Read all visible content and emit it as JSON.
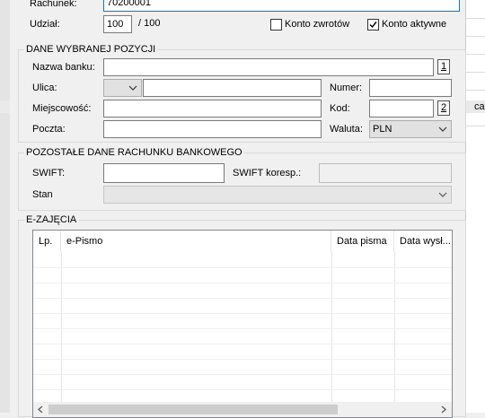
{
  "form": {
    "rachunek_label": "Rachunek:",
    "rachunek_value": "70200001",
    "udzial_label": "Udział:",
    "udzial_value": "100",
    "udzial_total": "/ 100",
    "konto_zwrotow_label": "Konto zwrotów",
    "konto_zwrotow_checked": false,
    "konto_aktywne_label": "Konto aktywne",
    "konto_aktywne_checked": true
  },
  "dane_pozycji": {
    "legend": "DANE WYBRANEJ POZYCJI",
    "nazwa_banku_label": "Nazwa banku:",
    "nazwa_banku_value": "",
    "btn1_label": "1",
    "ulica_label": "Ulica:",
    "ulica_prefix_value": "",
    "ulica_value": "",
    "numer_label": "Numer:",
    "numer_value": "",
    "miejscowosc_label": "Miejscowość:",
    "miejscowosc_value": "",
    "kod_label": "Kod:",
    "kod_value": "",
    "btn2_label": "2",
    "poczta_label": "Poczta:",
    "poczta_value": "",
    "waluta_label": "Waluta:",
    "waluta_value": "PLN"
  },
  "pozostale": {
    "legend": "POZOSTAŁE DANE RACHUNKU BANKOWEGO",
    "swift_label": "SWIFT:",
    "swift_value": "",
    "swift_koresp_label": "SWIFT koresp.:",
    "swift_koresp_value": "",
    "stan_label": "Stan",
    "stan_value": ""
  },
  "ezajecia": {
    "legend": "E-ZAJĘCIA",
    "columns": [
      "Lp.",
      "e-Pismo",
      "Data pisma",
      "Data wysł..."
    ]
  },
  "background": {
    "right_clip_text": "ca"
  }
}
